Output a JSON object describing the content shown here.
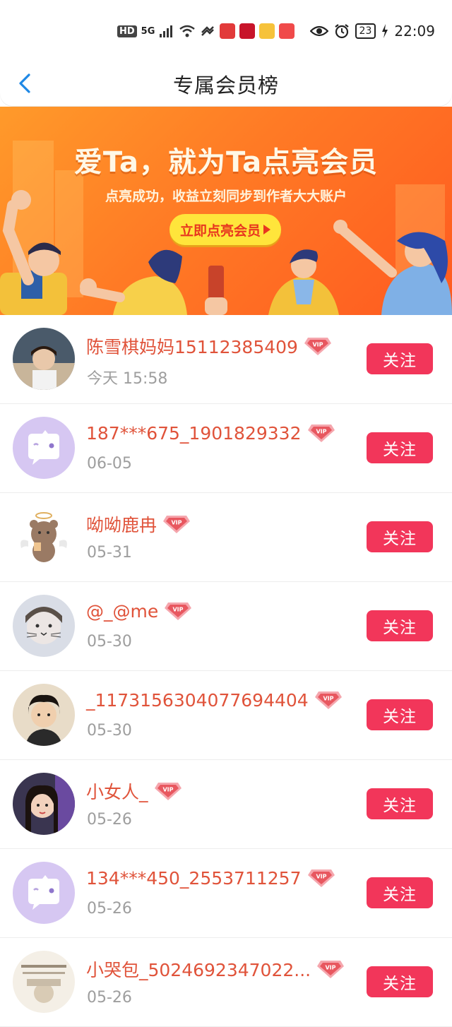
{
  "status_bar": {
    "left_indicators": [
      "HD",
      "5G"
    ],
    "time": "22:09",
    "battery": "23",
    "app_icons": [
      "起点",
      "天猫",
      "支付宝",
      "拼多多"
    ]
  },
  "header": {
    "title": "专属会员榜",
    "back_icon": "chevron-left-icon"
  },
  "banner": {
    "headline": "爱Ta，就为Ta点亮会员",
    "subtext": "点亮成功，收益立刻同步到作者大大账户",
    "cta_label": "立即点亮会员"
  },
  "members": [
    {
      "name": "陈雪棋妈妈15112385409",
      "date": "今天 15:58",
      "badge": "VIP",
      "follow_label": "关注",
      "avatar": "photo"
    },
    {
      "name": "187***675_1901829332",
      "date": "06-05",
      "badge": "VIP",
      "follow_label": "关注",
      "avatar": "default"
    },
    {
      "name": "呦呦鹿冉",
      "date": "05-31",
      "badge": "VIP",
      "follow_label": "关注",
      "avatar": "bear"
    },
    {
      "name": "@_@me",
      "date": "05-30",
      "badge": "VIP",
      "follow_label": "关注",
      "avatar": "photo"
    },
    {
      "name": "_1173156304077694404",
      "date": "05-30",
      "badge": "VIP",
      "follow_label": "关注",
      "avatar": "photo"
    },
    {
      "name": "小女人_",
      "date": "05-26",
      "badge": "VIP",
      "follow_label": "关注",
      "avatar": "photo"
    },
    {
      "name": "134***450_2553711257",
      "date": "05-26",
      "badge": "VIP",
      "follow_label": "关注",
      "avatar": "default"
    },
    {
      "name": "小哭包_5024692347022...",
      "date": "05-26",
      "badge": "VIP",
      "follow_label": "关注",
      "avatar": "photo"
    }
  ],
  "colors": {
    "accent_blue": "#1e88e5",
    "name_color": "#e0533a",
    "follow_button": "#f2365a",
    "banner_orange": "#ff7a25",
    "cta_yellow": "#ffe53b"
  }
}
